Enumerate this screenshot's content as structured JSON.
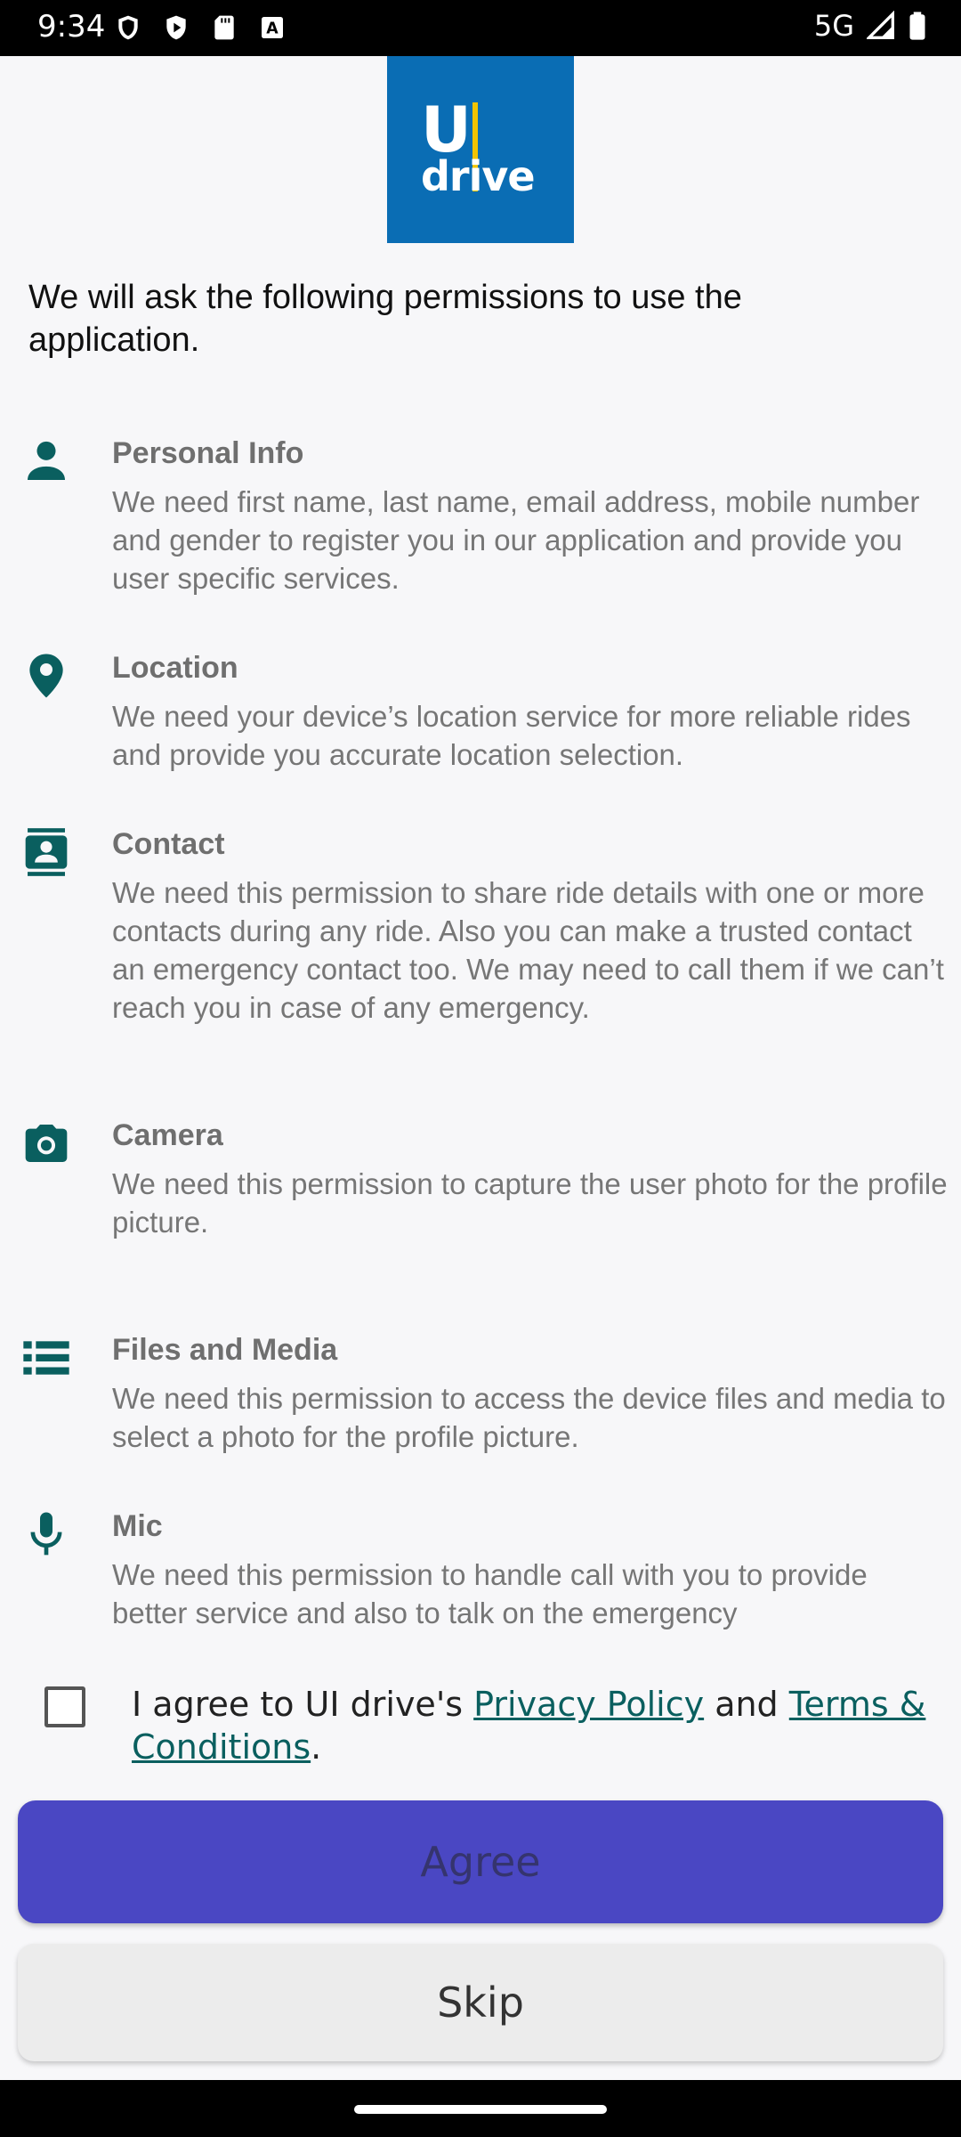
{
  "status_bar": {
    "time": "9:34",
    "network": "5G",
    "icons_left": [
      "shield-icon",
      "play-protect-icon",
      "sd-card-icon",
      "keyboard-a-icon"
    ],
    "icons_right": [
      "signal-icon",
      "battery-icon"
    ]
  },
  "logo": {
    "top": "U",
    "bottom": "drive",
    "brand_color": "#0a6db4",
    "accent_color": "#f2c400"
  },
  "intro": "We will ask the following permissions to use the application.",
  "permissions": [
    {
      "icon": "person-icon",
      "title": "Personal Info",
      "description": "We need first name, last name, email address, mobile number and gender to register you in our application and provide you user specific services."
    },
    {
      "icon": "location-pin-icon",
      "title": "Location",
      "description": "We need  your device’s location service for more reliable rides and provide you accurate location selection."
    },
    {
      "icon": "contact-card-icon",
      "title": "Contact",
      "description": "We need this permission to share ride details with one or more contacts during any ride. Also you can make a trusted contact an emergency contact too. We may need to call them if we can’t reach you in case of any emergency."
    },
    {
      "icon": "camera-icon",
      "title": "Camera",
      "description": "We need this permission to capture the user photo for the profile picture."
    },
    {
      "icon": "list-storage-icon",
      "title": "Files and Media",
      "description": "We need this permission to access the device files and media to select a photo for the profile picture."
    },
    {
      "icon": "mic-icon",
      "title": "Mic",
      "description": "We need this permission to handle call  with you to provide better service and also to talk on the emergency"
    }
  ],
  "agreement": {
    "prefix": "I agree to UI drive's ",
    "privacy_link": "Privacy Policy",
    "middle": " and ",
    "terms_link": "Terms & Conditions",
    "suffix": ".",
    "checked": false
  },
  "buttons": {
    "agree": "Agree",
    "skip": "Skip"
  },
  "colors": {
    "icon_teal": "#0a5f5f",
    "agree_button": "#4a47c3"
  }
}
